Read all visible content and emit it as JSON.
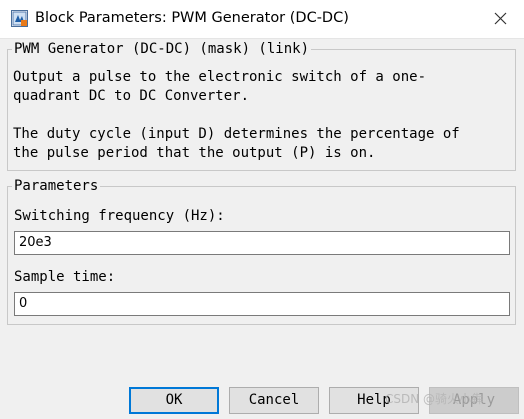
{
  "window": {
    "title": "Block Parameters: PWM Generator (DC-DC)",
    "icon": "simulink-block-icon",
    "close_icon": "close-icon"
  },
  "mask": {
    "title": "PWM Generator (DC-DC) (mask) (link)",
    "description_lines": [
      "Output a pulse to the electronic switch of a one-",
      "quadrant DC to DC Converter.",
      "",
      "The duty cycle (input D) determines the percentage of",
      "the pulse period that the output (P) is on."
    ]
  },
  "parameters": {
    "title": "Parameters",
    "switching_frequency": {
      "label": "Switching frequency (Hz):",
      "value": "20e3"
    },
    "sample_time": {
      "label": "Sample time:",
      "value": "0"
    }
  },
  "buttons": {
    "ok": "OK",
    "cancel": "Cancel",
    "help": "Help",
    "apply": "Apply"
  },
  "watermark": "CSDN @骑火小犇",
  "colors": {
    "accent": "#0078d7",
    "background": "#f0f0f0"
  }
}
